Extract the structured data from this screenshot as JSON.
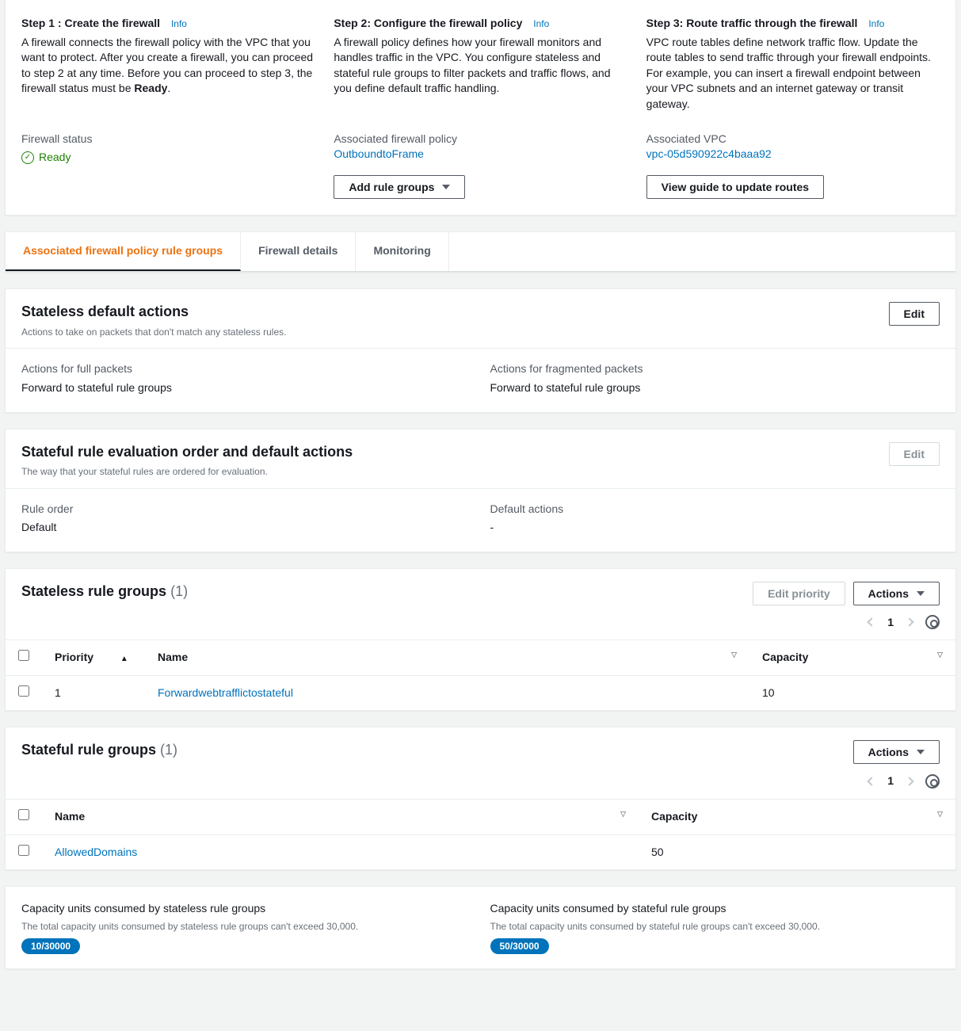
{
  "steps": {
    "s1": {
      "title": "Step 1 : Create the firewall",
      "info": "Info",
      "desc_a": "A firewall connects the firewall policy with the VPC that you want to protect. After you create a firewall, you can proceed to step 2 at any time. Before you can proceed to step 3, the firewall status must be ",
      "desc_b": "Ready",
      "status_label": "Firewall status",
      "status_value": "Ready"
    },
    "s2": {
      "title": "Step 2: Configure the firewall policy",
      "info": "Info",
      "desc": "A firewall policy defines how your firewall monitors and handles traffic in the VPC. You configure stateless and stateful rule groups to filter packets and traffic flows, and you define default traffic handling.",
      "assoc_label": "Associated firewall policy",
      "assoc_value": "OutboundtoFrame",
      "add_btn": "Add rule groups"
    },
    "s3": {
      "title": "Step 3: Route traffic through the firewall",
      "info": "Info",
      "desc": "VPC route tables define network traffic flow. Update the route tables to send traffic through your firewall endpoints. For example, you can insert a firewall endpoint between your VPC subnets and an internet gateway or transit gateway.",
      "assoc_label": "Associated VPC",
      "assoc_value": "vpc-05d590922c4baaa92",
      "guide_btn": "View guide to update routes"
    }
  },
  "tabs": {
    "t1": "Associated firewall policy rule groups",
    "t2": "Firewall details",
    "t3": "Monitoring"
  },
  "stateless_default": {
    "title": "Stateless default actions",
    "sub": "Actions to take on packets that don't match any stateless rules.",
    "edit": "Edit",
    "full_label": "Actions for full packets",
    "full_val": "Forward to stateful rule groups",
    "frag_label": "Actions for fragmented packets",
    "frag_val": "Forward to stateful rule groups"
  },
  "stateful_eval": {
    "title": "Stateful rule evaluation order and default actions",
    "sub": "The way that your stateful rules are ordered for evaluation.",
    "edit": "Edit",
    "order_label": "Rule order",
    "order_val": "Default",
    "def_label": "Default actions",
    "def_val": "-"
  },
  "stateless_groups": {
    "title": "Stateless rule groups",
    "count": "(1)",
    "edit_priority": "Edit priority",
    "actions": "Actions",
    "page": "1",
    "cols": {
      "priority": "Priority",
      "name": "Name",
      "capacity": "Capacity"
    },
    "rows": [
      {
        "priority": "1",
        "name": "Forwardwebtrafflictostateful",
        "capacity": "10"
      }
    ]
  },
  "stateful_groups": {
    "title": "Stateful rule groups",
    "count": "(1)",
    "actions": "Actions",
    "page": "1",
    "cols": {
      "name": "Name",
      "capacity": "Capacity"
    },
    "rows": [
      {
        "name": "AllowedDomains",
        "capacity": "50"
      }
    ]
  },
  "capacity": {
    "stateless_title": "Capacity units consumed by stateless rule groups",
    "stateless_sub": "The total capacity units consumed by stateless rule groups can't exceed 30,000.",
    "stateless_badge": "10/30000",
    "stateful_title": "Capacity units consumed by stateful rule groups",
    "stateful_sub": "The total capacity units consumed by stateful rule groups can't exceed 30,000.",
    "stateful_badge": "50/30000"
  }
}
